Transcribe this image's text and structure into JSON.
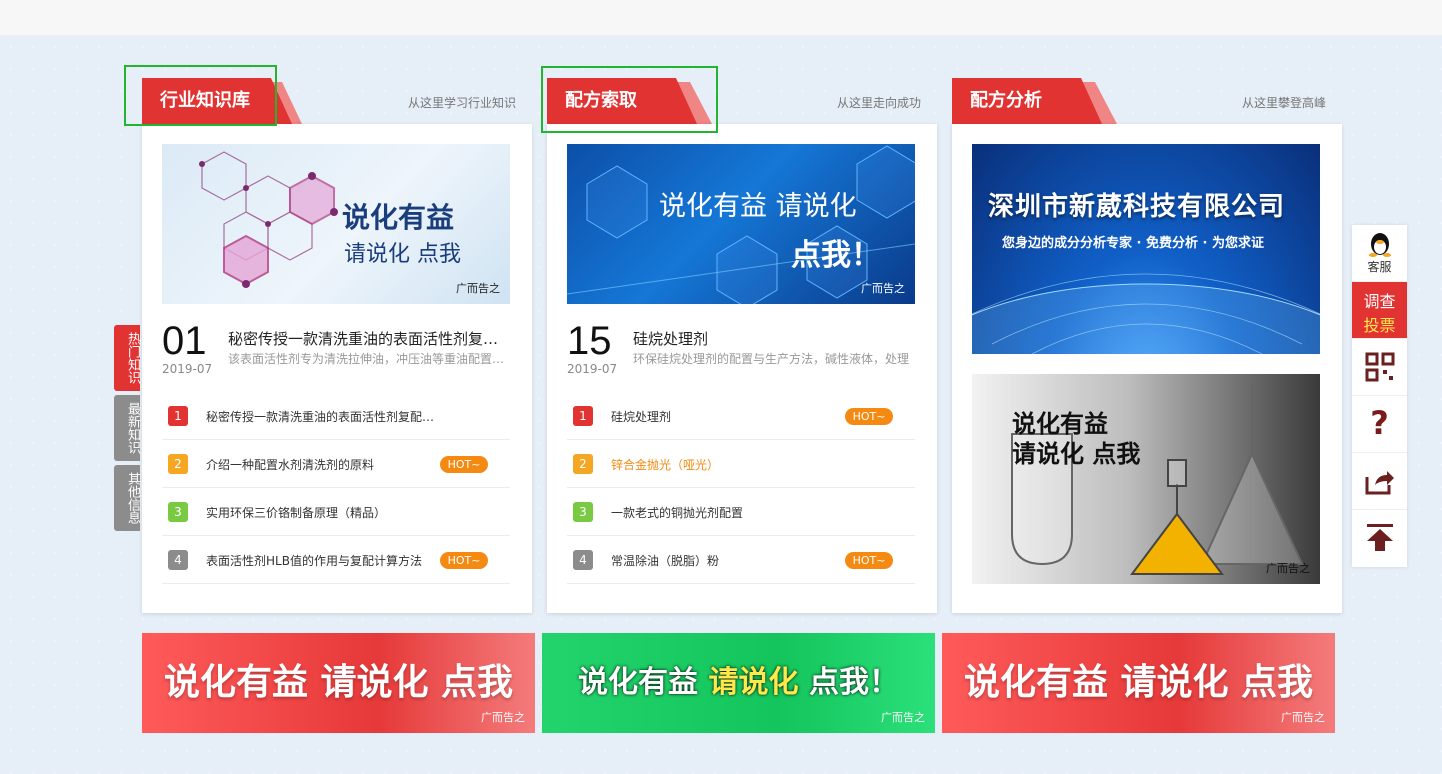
{
  "columns": [
    {
      "tab": "行业知识库",
      "subtitle": "从这里学习行业知识",
      "banner": {
        "line1": "说化有益",
        "line2": "请说化 点我",
        "ad": "广而告之"
      },
      "lead": {
        "day": "01",
        "ym": "2019-07",
        "title": "秘密传授一款清洗重油的表面活性剂复配方法",
        "desc": "该表面活性剂专为清洗拉伸油，冲压油等重油配置的复配方法"
      },
      "items": [
        {
          "n": "1",
          "text": "秘密传授一款清洗重油的表面活性剂复配方法（如果",
          "hot": ""
        },
        {
          "n": "2",
          "text": "介绍一种配置水剂清洗剂的原料",
          "hot": "HOT~"
        },
        {
          "n": "3",
          "text": "实用环保三价铬制备原理（精品）",
          "hot": ""
        },
        {
          "n": "4",
          "text": "表面活性剂HLB值的作用与复配计算方法",
          "hot": "HOT~"
        }
      ]
    },
    {
      "tab": "配方索取",
      "subtitle": "从这里走向成功",
      "banner": {
        "line1": "说化有益 请说化",
        "line2": "点我！",
        "ad": "广而告之"
      },
      "lead": {
        "day": "15",
        "ym": "2019-07",
        "title": "硅烷处理剂",
        "desc": "环保硅烷处理剂的配置与生产方法，碱性液体，处理"
      },
      "items": [
        {
          "n": "1",
          "text": "硅烷处理剂",
          "hot": "HOT~"
        },
        {
          "n": "2",
          "text": "锌合金抛光（哑光）",
          "hot": ""
        },
        {
          "n": "3",
          "text": "一款老式的铜抛光剂配置",
          "hot": ""
        },
        {
          "n": "4",
          "text": "常温除油（脱脂）粉",
          "hot": "HOT~"
        }
      ]
    },
    {
      "tab": "配方分析",
      "subtitle": "从这里攀登高峰",
      "banner_top": {
        "line1": "深圳市新葳科技有限公司",
        "line2": "您身边的成分分析专家 · 免费分析 · 为您求证"
      },
      "banner_bottom": {
        "line1": "说化有益",
        "line2": "请说化 点我",
        "ad": "广而告之"
      }
    }
  ],
  "bottom_ads": [
    {
      "text": "说化有益 请说化 点我",
      "ad": "广而告之"
    },
    {
      "text_a": "说化有益",
      "text_b": "请说化",
      "text_c": "点我！",
      "ad": "广而告之"
    },
    {
      "text": "说化有益 请说化 点我",
      "ad": "广而告之"
    }
  ],
  "side_tabs": [
    "热门知识",
    "最新知识",
    "其他信息"
  ],
  "right_sidebar": {
    "service": "客服",
    "survey_1": "调查",
    "survey_2": "投票",
    "help": "?"
  },
  "colors": {
    "accent_red": "#e23333",
    "hot_orange": "#f58a12",
    "num1": "#e23333",
    "num2": "#f5a623",
    "num3": "#7ac943",
    "num4": "#8c8c8c",
    "highlight": "#23b530"
  }
}
